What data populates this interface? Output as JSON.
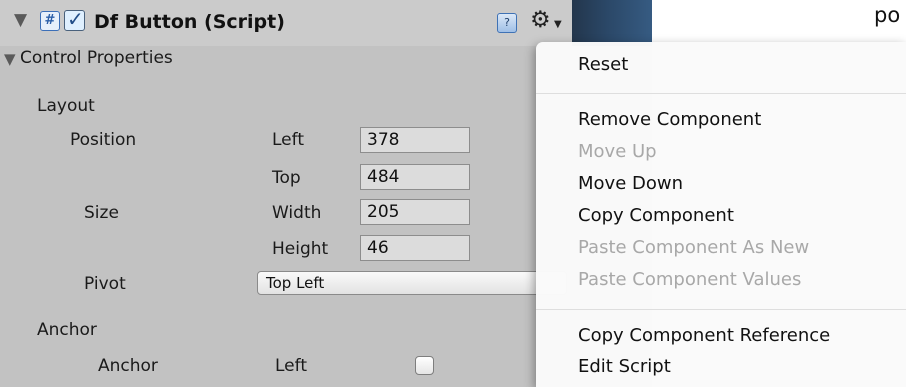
{
  "component": {
    "title": "Df Button (Script)",
    "enabled": true,
    "script_icon": "c#-script-icon",
    "help_icon": "help-book-icon",
    "gear_icon": "gear-icon"
  },
  "background_peek_text": "po",
  "section": {
    "title": "Control Properties",
    "layout": {
      "title": "Layout",
      "position": {
        "label": "Position",
        "left_label": "Left",
        "left_value": "378",
        "top_label": "Top",
        "top_value": "484"
      },
      "size": {
        "label": "Size",
        "width_label": "Width",
        "width_value": "205",
        "height_label": "Height",
        "height_value": "46"
      },
      "pivot": {
        "label": "Pivot",
        "value": "Top Left"
      }
    },
    "anchor": {
      "title": "Anchor",
      "label": "Anchor",
      "left_label": "Left",
      "left_checked": false
    }
  },
  "context_menu": {
    "items": [
      {
        "label": "Reset",
        "enabled": true
      },
      {
        "label": "Remove Component",
        "enabled": true
      },
      {
        "label": "Move Up",
        "enabled": false
      },
      {
        "label": "Move Down",
        "enabled": true
      },
      {
        "label": "Copy Component",
        "enabled": true
      },
      {
        "label": "Paste Component As New",
        "enabled": false
      },
      {
        "label": "Paste Component Values",
        "enabled": false
      },
      {
        "label": "Copy Component Reference",
        "enabled": true
      },
      {
        "label": "Edit Script",
        "enabled": true
      }
    ]
  },
  "colors": {
    "panel_bg": "#c2c2c2",
    "menu_bg": "#fafafa",
    "disabled_text": "#a8a8a8",
    "accent_blue": "#2b4868"
  }
}
